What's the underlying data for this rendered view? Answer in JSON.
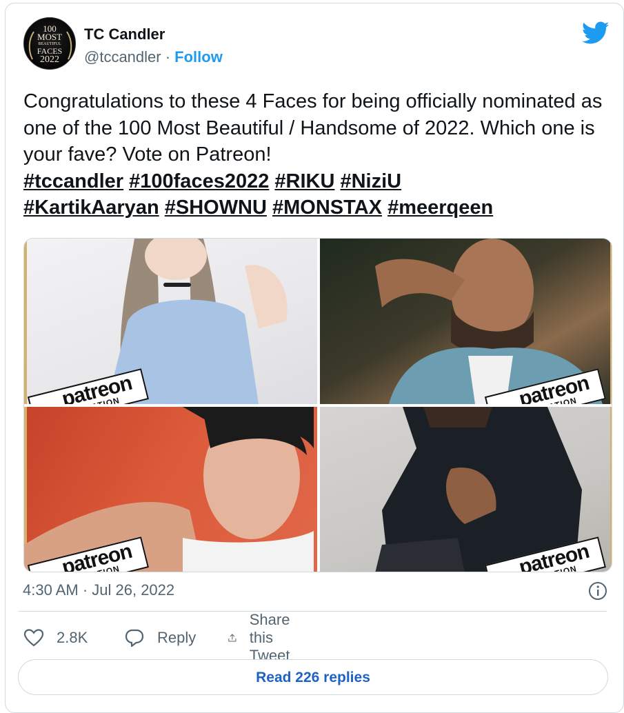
{
  "author": {
    "name": "TC Candler",
    "handle": "@tccandler",
    "separator": " · ",
    "follow_label": "Follow",
    "avatar_icon": "100-most-beautiful-faces-2022-logo",
    "avatar_text": [
      "100",
      "MOST",
      "BEAUTIFUL",
      "FACES",
      "2022"
    ]
  },
  "tweet": {
    "text": "Congratulations to these 4 Faces for being officially nominated as one of the 100 Most Beautiful / Handsome of 2022.  Which one is your fave?  Vote on Patreon!",
    "hashtags": [
      "#tccandler",
      "#100faces2022",
      "#RIKU",
      "#NiziU",
      "#KartikAaryan",
      "#SHOWNU",
      "#MONSTAX",
      "#meerqeen"
    ]
  },
  "media": {
    "badge_word": "patreon",
    "badge_sub": "NOMINATION",
    "photos": [
      "nominee-photo-1",
      "nominee-photo-2",
      "nominee-photo-3",
      "nominee-photo-4"
    ]
  },
  "timestamp": "4:30 AM · Jul 26, 2022",
  "actions": {
    "like_count": "2.8K",
    "reply_label": "Reply",
    "share_label": "Share this Tweet"
  },
  "read_replies_label": "Read 226 replies",
  "colors": {
    "accent": "#1d9bf0",
    "link": "#1d62c4",
    "muted": "#536471",
    "border": "#cfd9de"
  }
}
